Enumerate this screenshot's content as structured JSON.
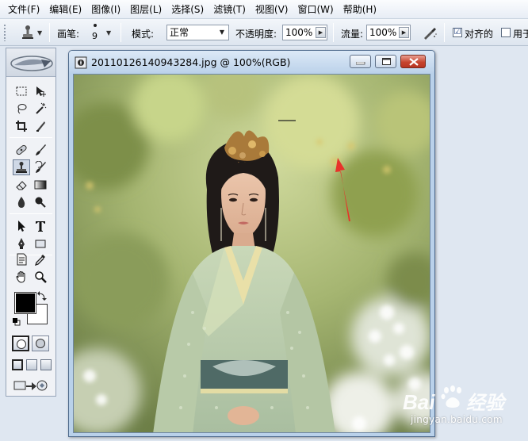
{
  "menu": [
    "文件(F)",
    "编辑(E)",
    "图像(I)",
    "图层(L)",
    "选择(S)",
    "滤镜(T)",
    "视图(V)",
    "窗口(W)",
    "帮助(H)"
  ],
  "options": {
    "brush_label": "画笔:",
    "brush_size": "9",
    "mode_label": "模式:",
    "mode_value": "正常",
    "opacity_label": "不透明度:",
    "opacity_value": "100%",
    "flow_label": "流量:",
    "flow_value": "100%",
    "aligned_label": "对齐的",
    "aligned_checked": "☑",
    "sample_label": "用于"
  },
  "document": {
    "title": "20110126140943284.jpg @ 100%(RGB)"
  },
  "annotation": {
    "arrow_color": "#e8322a"
  },
  "watermark": {
    "url": "jingyan.baidu.com"
  }
}
